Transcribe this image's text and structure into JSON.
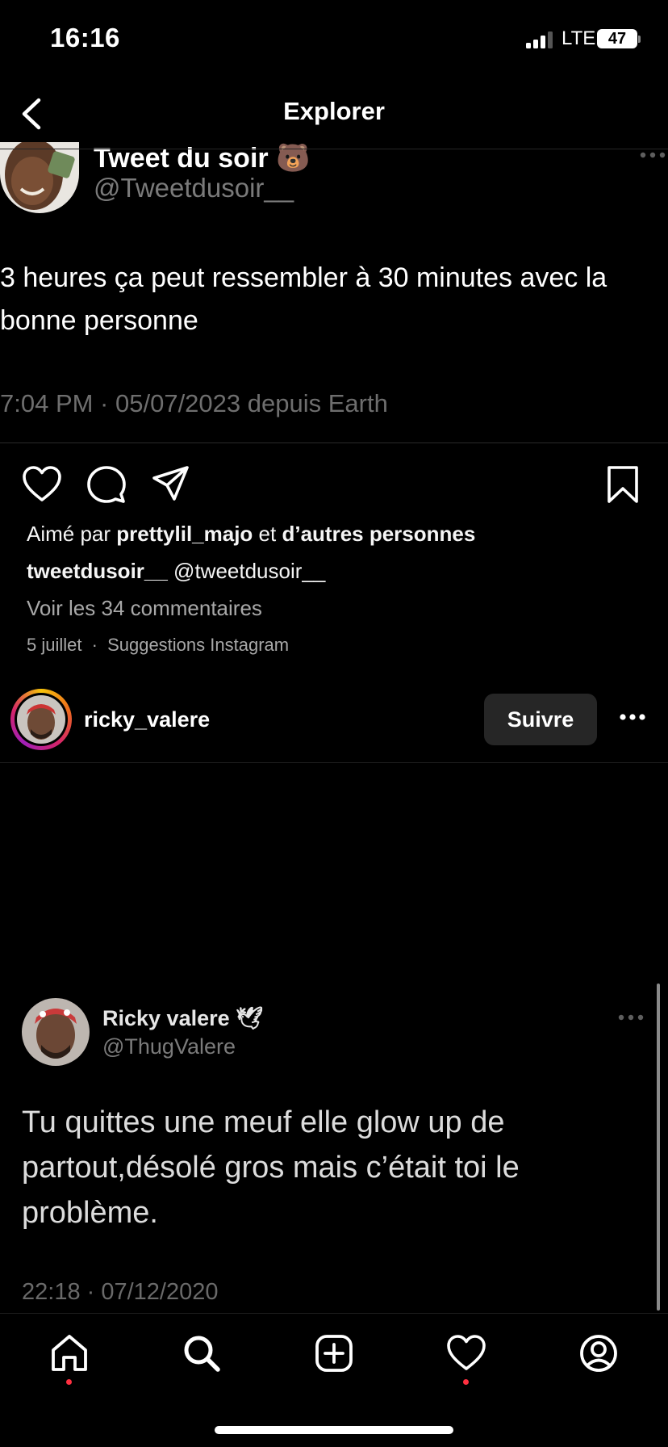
{
  "status_bar": {
    "time": "16:16",
    "network": "LTE",
    "battery": "47"
  },
  "header": {
    "title": "Explorer"
  },
  "tweet1": {
    "name": "Tweet du soir",
    "handle": "@Tweetdusoir__",
    "text": "3 heures ça peut ressembler à 30 minutes avec la bonne personne",
    "meta": "7:04 PM · 05/07/2023 depuis Earth"
  },
  "post1": {
    "liked_prefix": "Aimé par ",
    "liked_user": "prettylil_majo",
    "liked_mid": " et ",
    "liked_rest": "d’autres personnes",
    "caption_user": "tweetdusoir__",
    "caption_text": " @tweetdusoir__",
    "comments": "Voir les 34 commentaires",
    "date": "5 juillet",
    "separator": "·",
    "suggestion": "Suggestions Instagram"
  },
  "post2": {
    "username": "ricky_valere",
    "follow_label": "Suivre"
  },
  "tweet2": {
    "name": "Ricky valere",
    "handle": "@ThugValere",
    "text": "Tu quittes une meuf elle glow up de partout,désolé gros mais c’était toi le problème.",
    "meta": "22:18 · 07/12/2020"
  },
  "tabs": [
    "home-icon",
    "search-icon",
    "create-icon",
    "activity-icon",
    "profile-icon"
  ],
  "colors": {
    "background": "#000000",
    "notification_dot": "#ff3040",
    "follow_button": "#262626"
  }
}
